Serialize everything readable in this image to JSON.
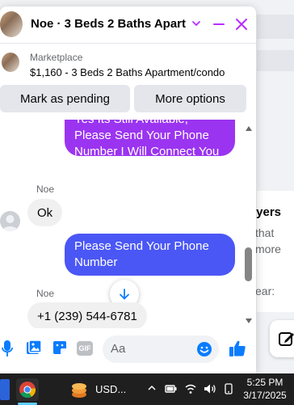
{
  "background": {
    "card_heading": "uyers",
    "card_line1": "that",
    "card_line2": "more",
    "card_line3": "ear:"
  },
  "chat": {
    "title": "Noe · 3 Beds 2 Baths Apart...",
    "listing": {
      "kicker": "Marketplace",
      "title": "$1,160 - 3 Beds 2 Baths Apartment/condo"
    },
    "buttons": {
      "mark_pending": "Mark as pending",
      "more_options": "More options"
    },
    "messages": [
      {
        "direction": "outgoing",
        "text": "Yes Its Still Available, Please Send Your Phone Number I Will Connect You Soon.."
      },
      {
        "direction": "incoming",
        "sender": "Noe",
        "text": "Ok"
      },
      {
        "direction": "outgoing",
        "text": "Please Send Your Phone Number"
      },
      {
        "direction": "incoming",
        "sender": "Noe",
        "text": "+1 (239) 544-6781"
      }
    ],
    "composer": {
      "placeholder": "Aa"
    },
    "colors": {
      "accent": "#b92dfd",
      "bubble_purple": "#9b34f0",
      "bubble_blue": "#4a57f5",
      "icon_blue": "#0a7cff"
    }
  },
  "taskbar": {
    "app_label": "USD...",
    "time": "5:25 PM",
    "date": "3/17/2025"
  }
}
